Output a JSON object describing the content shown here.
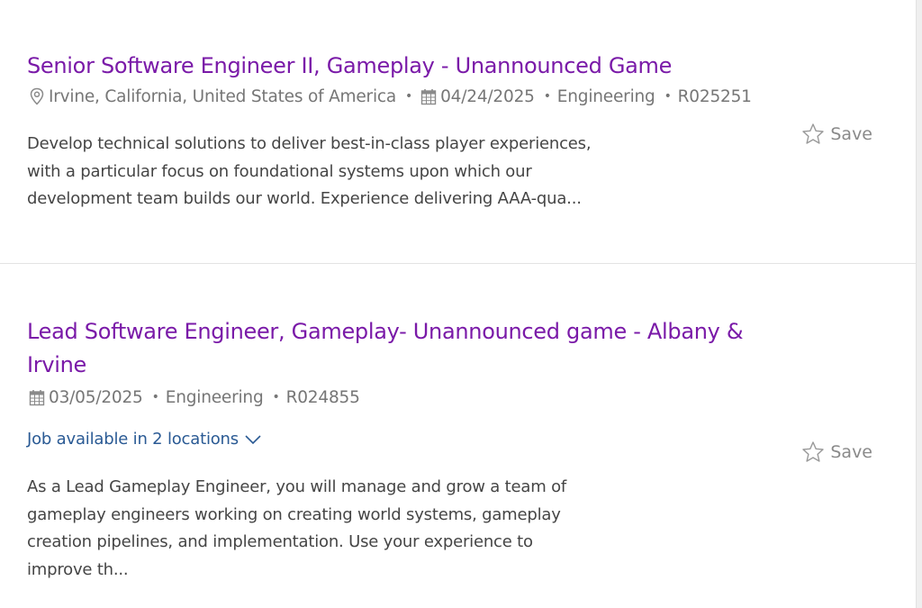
{
  "jobs": [
    {
      "title": "Senior Software Engineer II, Gameplay - Unannounced Game",
      "location": "Irvine, California, United States of America",
      "date": "04/24/2025",
      "category": "Engineering",
      "req_id": "R025251",
      "description_lines": [
        "Develop technical solutions to deliver best-in-class player experiences,",
        "with a particular focus on foundational systems upon which our",
        "development team builds our world. Experience delivering AAA-qua..."
      ],
      "save_label": "Save"
    },
    {
      "title_lines": [
        "Lead Software Engineer, Gameplay- Unannounced game - Albany &",
        "Irvine"
      ],
      "date": "03/05/2025",
      "category": "Engineering",
      "req_id": "R024855",
      "locations_link": "Job available in 2 locations",
      "description_lines": [
        "As a Lead Gameplay Engineer, you will manage and grow a team of",
        "gameplay engineers working on creating world systems, gameplay",
        "creation pipelines, and implementation. Use your experience to",
        "improve th..."
      ],
      "save_label": "Save"
    }
  ],
  "separator": "•",
  "colors": {
    "title": "#7a1aa8",
    "meta": "#767676",
    "description": "#454545",
    "link": "#2a5a94",
    "save": "#8a8a8a",
    "divider": "#e3e3e3"
  },
  "icons": {
    "location": "map-pin-icon",
    "date": "calendar-icon",
    "save": "star-outline-icon",
    "expand": "chevron-down-icon"
  }
}
